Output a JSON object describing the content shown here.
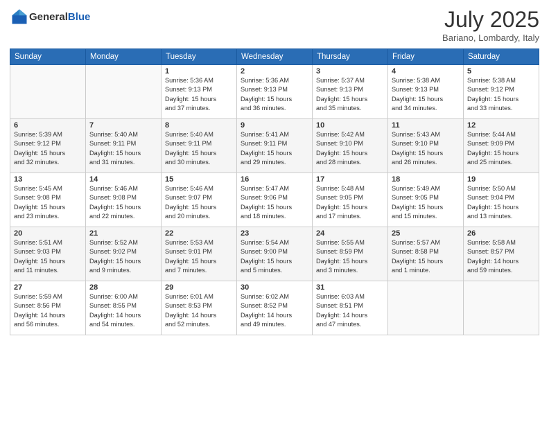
{
  "header": {
    "logo": {
      "general": "General",
      "blue": "Blue"
    },
    "title": "July 2025",
    "location": "Bariano, Lombardy, Italy"
  },
  "weekdays": [
    "Sunday",
    "Monday",
    "Tuesday",
    "Wednesday",
    "Thursday",
    "Friday",
    "Saturday"
  ],
  "weeks": [
    [
      {
        "day": "",
        "info": ""
      },
      {
        "day": "",
        "info": ""
      },
      {
        "day": "1",
        "info": "Sunrise: 5:36 AM\nSunset: 9:13 PM\nDaylight: 15 hours\nand 37 minutes."
      },
      {
        "day": "2",
        "info": "Sunrise: 5:36 AM\nSunset: 9:13 PM\nDaylight: 15 hours\nand 36 minutes."
      },
      {
        "day": "3",
        "info": "Sunrise: 5:37 AM\nSunset: 9:13 PM\nDaylight: 15 hours\nand 35 minutes."
      },
      {
        "day": "4",
        "info": "Sunrise: 5:38 AM\nSunset: 9:13 PM\nDaylight: 15 hours\nand 34 minutes."
      },
      {
        "day": "5",
        "info": "Sunrise: 5:38 AM\nSunset: 9:12 PM\nDaylight: 15 hours\nand 33 minutes."
      }
    ],
    [
      {
        "day": "6",
        "info": "Sunrise: 5:39 AM\nSunset: 9:12 PM\nDaylight: 15 hours\nand 32 minutes."
      },
      {
        "day": "7",
        "info": "Sunrise: 5:40 AM\nSunset: 9:11 PM\nDaylight: 15 hours\nand 31 minutes."
      },
      {
        "day": "8",
        "info": "Sunrise: 5:40 AM\nSunset: 9:11 PM\nDaylight: 15 hours\nand 30 minutes."
      },
      {
        "day": "9",
        "info": "Sunrise: 5:41 AM\nSunset: 9:11 PM\nDaylight: 15 hours\nand 29 minutes."
      },
      {
        "day": "10",
        "info": "Sunrise: 5:42 AM\nSunset: 9:10 PM\nDaylight: 15 hours\nand 28 minutes."
      },
      {
        "day": "11",
        "info": "Sunrise: 5:43 AM\nSunset: 9:10 PM\nDaylight: 15 hours\nand 26 minutes."
      },
      {
        "day": "12",
        "info": "Sunrise: 5:44 AM\nSunset: 9:09 PM\nDaylight: 15 hours\nand 25 minutes."
      }
    ],
    [
      {
        "day": "13",
        "info": "Sunrise: 5:45 AM\nSunset: 9:08 PM\nDaylight: 15 hours\nand 23 minutes."
      },
      {
        "day": "14",
        "info": "Sunrise: 5:46 AM\nSunset: 9:08 PM\nDaylight: 15 hours\nand 22 minutes."
      },
      {
        "day": "15",
        "info": "Sunrise: 5:46 AM\nSunset: 9:07 PM\nDaylight: 15 hours\nand 20 minutes."
      },
      {
        "day": "16",
        "info": "Sunrise: 5:47 AM\nSunset: 9:06 PM\nDaylight: 15 hours\nand 18 minutes."
      },
      {
        "day": "17",
        "info": "Sunrise: 5:48 AM\nSunset: 9:05 PM\nDaylight: 15 hours\nand 17 minutes."
      },
      {
        "day": "18",
        "info": "Sunrise: 5:49 AM\nSunset: 9:05 PM\nDaylight: 15 hours\nand 15 minutes."
      },
      {
        "day": "19",
        "info": "Sunrise: 5:50 AM\nSunset: 9:04 PM\nDaylight: 15 hours\nand 13 minutes."
      }
    ],
    [
      {
        "day": "20",
        "info": "Sunrise: 5:51 AM\nSunset: 9:03 PM\nDaylight: 15 hours\nand 11 minutes."
      },
      {
        "day": "21",
        "info": "Sunrise: 5:52 AM\nSunset: 9:02 PM\nDaylight: 15 hours\nand 9 minutes."
      },
      {
        "day": "22",
        "info": "Sunrise: 5:53 AM\nSunset: 9:01 PM\nDaylight: 15 hours\nand 7 minutes."
      },
      {
        "day": "23",
        "info": "Sunrise: 5:54 AM\nSunset: 9:00 PM\nDaylight: 15 hours\nand 5 minutes."
      },
      {
        "day": "24",
        "info": "Sunrise: 5:55 AM\nSunset: 8:59 PM\nDaylight: 15 hours\nand 3 minutes."
      },
      {
        "day": "25",
        "info": "Sunrise: 5:57 AM\nSunset: 8:58 PM\nDaylight: 15 hours\nand 1 minute."
      },
      {
        "day": "26",
        "info": "Sunrise: 5:58 AM\nSunset: 8:57 PM\nDaylight: 14 hours\nand 59 minutes."
      }
    ],
    [
      {
        "day": "27",
        "info": "Sunrise: 5:59 AM\nSunset: 8:56 PM\nDaylight: 14 hours\nand 56 minutes."
      },
      {
        "day": "28",
        "info": "Sunrise: 6:00 AM\nSunset: 8:55 PM\nDaylight: 14 hours\nand 54 minutes."
      },
      {
        "day": "29",
        "info": "Sunrise: 6:01 AM\nSunset: 8:53 PM\nDaylight: 14 hours\nand 52 minutes."
      },
      {
        "day": "30",
        "info": "Sunrise: 6:02 AM\nSunset: 8:52 PM\nDaylight: 14 hours\nand 49 minutes."
      },
      {
        "day": "31",
        "info": "Sunrise: 6:03 AM\nSunset: 8:51 PM\nDaylight: 14 hours\nand 47 minutes."
      },
      {
        "day": "",
        "info": ""
      },
      {
        "day": "",
        "info": ""
      }
    ]
  ]
}
